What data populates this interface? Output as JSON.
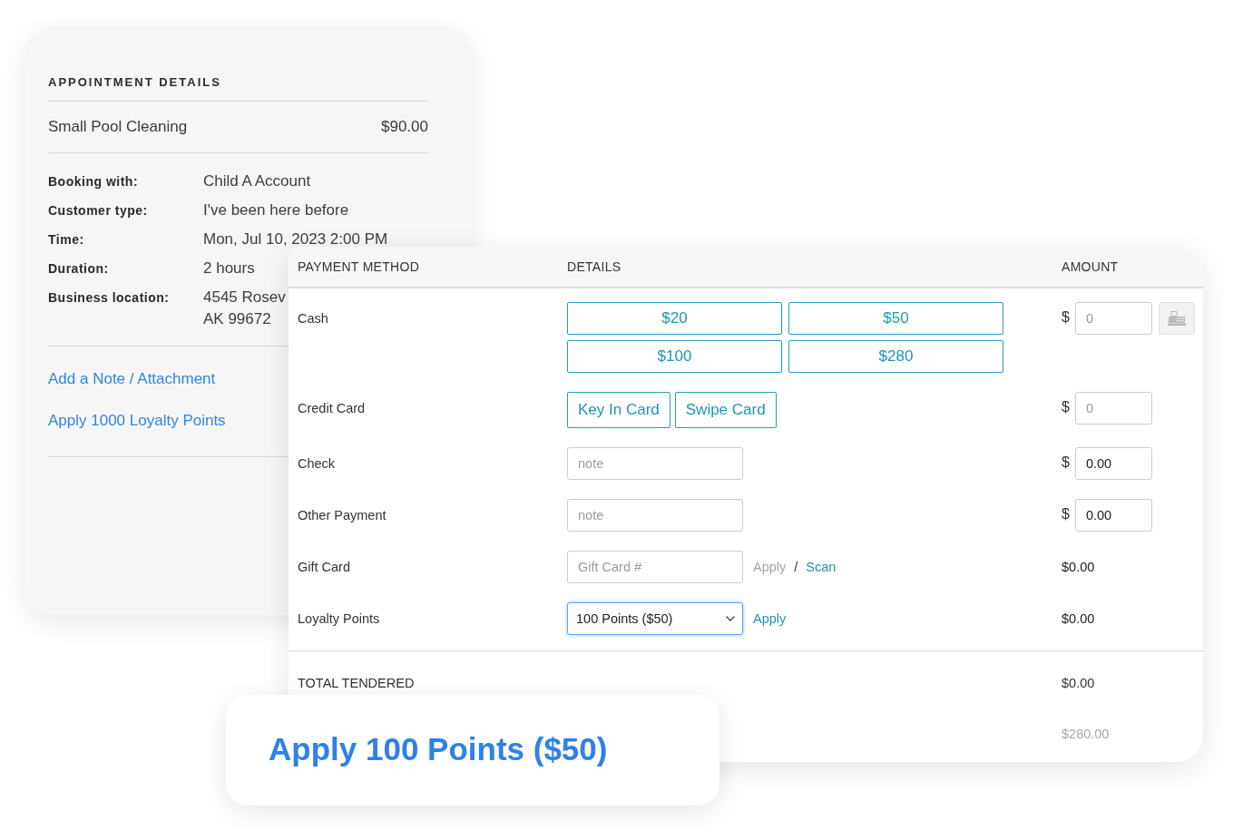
{
  "appointment_details": {
    "title": "APPOINTMENT DETAILS",
    "service": {
      "name": "Small Pool Cleaning",
      "price": "$90.00"
    },
    "details": [
      {
        "label": "Booking with:",
        "lines": [
          "Child A Account"
        ]
      },
      {
        "label": "Customer type:",
        "lines": [
          "I've been here before"
        ]
      },
      {
        "label": "Time:",
        "lines": [
          "Mon, Jul 10, 2023 2:00 PM"
        ]
      },
      {
        "label": "Duration:",
        "lines": [
          "2 hours"
        ]
      },
      {
        "label": "Business location:",
        "lines": [
          "4545 Rosev",
          "AK 99672"
        ]
      }
    ],
    "links": [
      "Add a Note / Attachment",
      "Apply 1000 Loyalty Points"
    ]
  },
  "payment": {
    "columns": [
      "PAYMENT METHOD",
      "DETAILS",
      "AMOUNT"
    ],
    "rows": [
      {
        "method": "Cash",
        "details": {
          "kind": "amount_buttons",
          "buttons": [
            "$20",
            "$50",
            "$100",
            "$280"
          ]
        },
        "amount": {
          "kind": "input",
          "currency": "$",
          "placeholder": "0",
          "register_button": {
            "disabled": true
          }
        }
      },
      {
        "method": "Credit Card",
        "details": {
          "kind": "card_buttons",
          "buttons": [
            "Key In Card",
            "Swipe Card"
          ]
        },
        "amount": {
          "kind": "input",
          "currency": "$",
          "placeholder": "0"
        }
      },
      {
        "method": "Check",
        "details": {
          "kind": "note",
          "placeholder": "note"
        },
        "amount": {
          "kind": "input",
          "currency": "$",
          "value": "0.00"
        }
      },
      {
        "method": "Other Payment",
        "details": {
          "kind": "note",
          "placeholder": "note"
        },
        "amount": {
          "kind": "input",
          "currency": "$",
          "value": "0.00"
        }
      },
      {
        "method": "Gift Card",
        "details": {
          "kind": "gift_card",
          "placeholder": "Gift Card #",
          "separator": "/",
          "actions": [
            {
              "label": "Apply",
              "disabled": true
            },
            {
              "label": "Scan",
              "disabled": false
            }
          ]
        },
        "amount": {
          "kind": "text",
          "value": "$0.00"
        }
      },
      {
        "method": "Loyalty Points",
        "details": {
          "kind": "select",
          "value": "100 Points ($50)",
          "focused": true,
          "actions": [
            {
              "label": "Apply",
              "disabled": false
            }
          ]
        },
        "amount": {
          "kind": "text",
          "value": "$0.00"
        }
      }
    ],
    "totals": [
      {
        "label": "TOTAL TENDERED",
        "amount": "$0.00",
        "disabled": false
      },
      {
        "amount": "$280.00",
        "disabled": true
      }
    ]
  },
  "callout": {
    "text": "Apply 100 Points ($50)"
  }
}
